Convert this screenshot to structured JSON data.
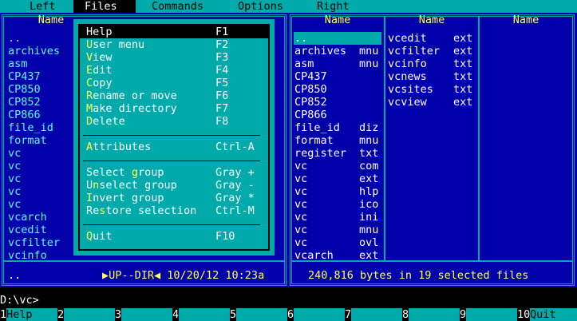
{
  "menubar": {
    "items": [
      "Left",
      "Files",
      "Commands",
      "Options",
      "Right"
    ],
    "active": "Files"
  },
  "left_panel": {
    "header": "Name",
    "files": [
      "..",
      "archives",
      "asm",
      "CP437",
      "CP850",
      "CP852",
      "CP866",
      "file_id",
      "format",
      "vc",
      "vc",
      "vc",
      "vc",
      "vc",
      "vcarch",
      "vcedit",
      "vcfilter",
      "vcinfo"
    ],
    "status_name": "..",
    "status_info": "▶UP--DIR◀ 10/20/12 10:23a"
  },
  "right_panel": {
    "headers": [
      "Name",
      "Name",
      "Name"
    ],
    "col1": [
      {
        "name": "..",
        "ext": ""
      },
      {
        "name": "archives",
        "ext": "mnu"
      },
      {
        "name": "asm",
        "ext": "mnu"
      },
      {
        "name": "CP437",
        "ext": ""
      },
      {
        "name": "CP850",
        "ext": ""
      },
      {
        "name": "CP852",
        "ext": ""
      },
      {
        "name": "CP866",
        "ext": ""
      },
      {
        "name": "file_id",
        "ext": "diz"
      },
      {
        "name": "format",
        "ext": "mnu"
      },
      {
        "name": "register",
        "ext": "txt"
      },
      {
        "name": "vc",
        "ext": "com"
      },
      {
        "name": "vc",
        "ext": "ext"
      },
      {
        "name": "vc",
        "ext": "hlp"
      },
      {
        "name": "vc",
        "ext": "ico"
      },
      {
        "name": "vc",
        "ext": "ini"
      },
      {
        "name": "vc",
        "ext": "mnu"
      },
      {
        "name": "vc",
        "ext": "ovl"
      },
      {
        "name": "vcarch",
        "ext": "ext"
      }
    ],
    "col2": [
      {
        "name": "vcedit",
        "ext": "ext"
      },
      {
        "name": "vcfilter",
        "ext": "ext"
      },
      {
        "name": "vcinfo",
        "ext": "txt"
      },
      {
        "name": "vcnews",
        "ext": "txt"
      },
      {
        "name": "vcsites",
        "ext": "txt"
      },
      {
        "name": "vcview",
        "ext": "ext"
      }
    ],
    "status": "240,816 bytes in 19 selected files"
  },
  "files_menu": {
    "items": [
      {
        "pre": "",
        "hot": "H",
        "post": "elp",
        "key": "F1"
      },
      {
        "pre": "",
        "hot": "U",
        "post": "ser menu",
        "key": "F2"
      },
      {
        "pre": "",
        "hot": "V",
        "post": "iew",
        "key": "F3"
      },
      {
        "pre": "",
        "hot": "E",
        "post": "dit",
        "key": "F4"
      },
      {
        "pre": "",
        "hot": "C",
        "post": "opy",
        "key": "F5"
      },
      {
        "pre": "",
        "hot": "R",
        "post": "ename or move",
        "key": "F6"
      },
      {
        "pre": "",
        "hot": "M",
        "post": "ake directory",
        "key": "F7"
      },
      {
        "pre": "",
        "hot": "D",
        "post": "elete",
        "key": "F8"
      },
      {
        "pre": "",
        "hot": "A",
        "post": "ttributes",
        "key": "Ctrl-A"
      },
      {
        "pre": "Select ",
        "hot": "g",
        "post": "roup",
        "key": "Gray +"
      },
      {
        "pre": "U",
        "hot": "n",
        "post": "select group",
        "key": "Gray -"
      },
      {
        "pre": "",
        "hot": "I",
        "post": "nvert group",
        "key": "Gray *"
      },
      {
        "pre": "Re",
        "hot": "s",
        "post": "tore selection",
        "key": "Ctrl-M"
      },
      {
        "pre": "",
        "hot": "Q",
        "post": "uit",
        "key": "F10"
      }
    ],
    "selected_index": 0
  },
  "command_line": "D:\\vc>",
  "function_keys": [
    {
      "num": "1",
      "label": "Help"
    },
    {
      "num": "2",
      "label": ""
    },
    {
      "num": "3",
      "label": ""
    },
    {
      "num": "4",
      "label": ""
    },
    {
      "num": "5",
      "label": ""
    },
    {
      "num": "6",
      "label": ""
    },
    {
      "num": "7",
      "label": ""
    },
    {
      "num": "8",
      "label": ""
    },
    {
      "num": "9",
      "label": ""
    },
    {
      "num": "10",
      "label": "Quit"
    }
  ],
  "colors": {
    "panel_bg": "#0000aa",
    "frame": "#00aaaa",
    "header": "#ffff55",
    "file": "#55ffff",
    "hotkey": "#ffff55"
  }
}
